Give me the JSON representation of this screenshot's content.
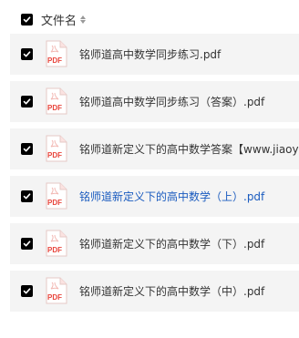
{
  "header": {
    "label": "文件名"
  },
  "files": [
    {
      "name": "铭师道高中数学同步练习.pdf",
      "checked": true,
      "highlight": false
    },
    {
      "name": "铭师道高中数学同步练习（答案）.pdf",
      "checked": true,
      "highlight": false
    },
    {
      "name": "铭师道新定义下的高中数学答案【www.jiaoyu",
      "checked": true,
      "highlight": false
    },
    {
      "name": "铭师道新定义下的高中数学（上）.pdf",
      "checked": true,
      "highlight": true
    },
    {
      "name": "铭师道新定义下的高中数学（下）.pdf",
      "checked": true,
      "highlight": false
    },
    {
      "name": "铭师道新定义下的高中数学（中）.pdf",
      "checked": true,
      "highlight": false
    }
  ],
  "icon_text": "PDF",
  "colors": {
    "row_bg": "#f4f4f4",
    "link": "#1a5bbf",
    "pdf_red": "#e8453c"
  }
}
